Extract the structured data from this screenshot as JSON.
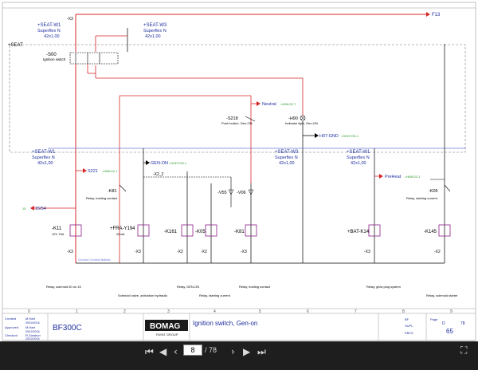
{
  "colors": {
    "wire_red": "#d62728",
    "wire_blue": "#1f2f9f",
    "wire_black": "#000000",
    "bus": "#6a7ad8",
    "ref_green": "#2e9a2e",
    "contact_purple": "#8a1f8a"
  },
  "rails": {
    "top": "-X3",
    "seat_left": "+SEAT",
    "bottom_bus": "Ground Central Ballast"
  },
  "connectors_top": [
    {
      "name": "+SEAT-W1",
      "cable": "Superflex N",
      "spec": "42x1,00"
    },
    {
      "name": "+SEAT-W3",
      "cable": "Superflex N",
      "spec": "42x1,00"
    }
  ],
  "connectors_mid": [
    {
      "name": "+SEAT-W1",
      "cable": "Superflex N",
      "spec": "42x1,00"
    },
    {
      "name": "+SEAT-W3",
      "cable": "Superflex N",
      "spec": "42x1,00"
    },
    {
      "name": "+SEAT-W1",
      "cable": "Superflex N",
      "spec": "42x1,00"
    }
  ],
  "signals": {
    "f13": "F13",
    "s221": "S221",
    "gen_on": "GEN-ON",
    "neutral": "Neutral",
    "h07": "H07:GND",
    "preheat": "PreHeat",
    "t15": "15/54",
    "t15_left": "15"
  },
  "switch": {
    "name": "-S00",
    "desc": "Ignition switch"
  },
  "pushbutton": {
    "name": "-S218",
    "desc": "Push button, Gen-ON"
  },
  "lamp": {
    "name": "-H90",
    "desc": "Indicator light, Gen-ON"
  },
  "relays_small": [
    {
      "name": "-K81",
      "desc": "Relay, holding contact"
    },
    {
      "name": "-K05",
      "desc": "Relay, starting current"
    }
  ],
  "diodes": [
    "-V55",
    "-V06"
  ],
  "components": [
    {
      "name": "-K11",
      "sub": "12V 70A",
      "desc": "Relay, solenoid 30 on 15"
    },
    {
      "name": "+FRA-Y194",
      "sub": "20mA",
      "desc": "Solenoid valve, activation hydraulic"
    },
    {
      "name": "-K161",
      "sub": "",
      "desc": "Relay, GEN-ON"
    },
    {
      "name": "-K05",
      "sub": "",
      "desc": "Relay, starting current"
    },
    {
      "name": "-K81",
      "sub": "",
      "desc": "Relay, holding contact"
    },
    {
      "name": "+BAT-K14",
      "sub": "",
      "desc": "Relay, glow plug system"
    },
    {
      "name": "-K145",
      "sub": "",
      "desc": "Relay, solenoid starter"
    }
  ],
  "ground_labels": [
    "-X3",
    "-X3",
    "-X3",
    "-X2",
    "-X2",
    "-X3",
    "-X3",
    "-X2"
  ],
  "column_numbers": [
    "0",
    "1",
    "2",
    "3",
    "4",
    "5",
    "6",
    "7",
    "8",
    "9"
  ],
  "title_block": {
    "created_label": "Created",
    "created_by": "M.Hart",
    "created_date": "09/10/2016",
    "approved_label": "Approved",
    "approved_by": "M.Hart",
    "approved_date": "09/10/2016",
    "checked_label": "Checked",
    "checked_by": "R.Zambon",
    "checked_date": "20/10/2016",
    "model": "BF300C",
    "logo": "BOMAG",
    "logo_sub": "FAYAT GROUP",
    "title": "Ignition switch, Gen-on",
    "plant": "BF",
    "location": "SUPL",
    "doc": "EBC5",
    "page_label": "Page",
    "page": "D",
    "page_of": "78",
    "sheet_no": "65"
  },
  "viewer": {
    "current_page": "8",
    "total": "/ 78"
  }
}
